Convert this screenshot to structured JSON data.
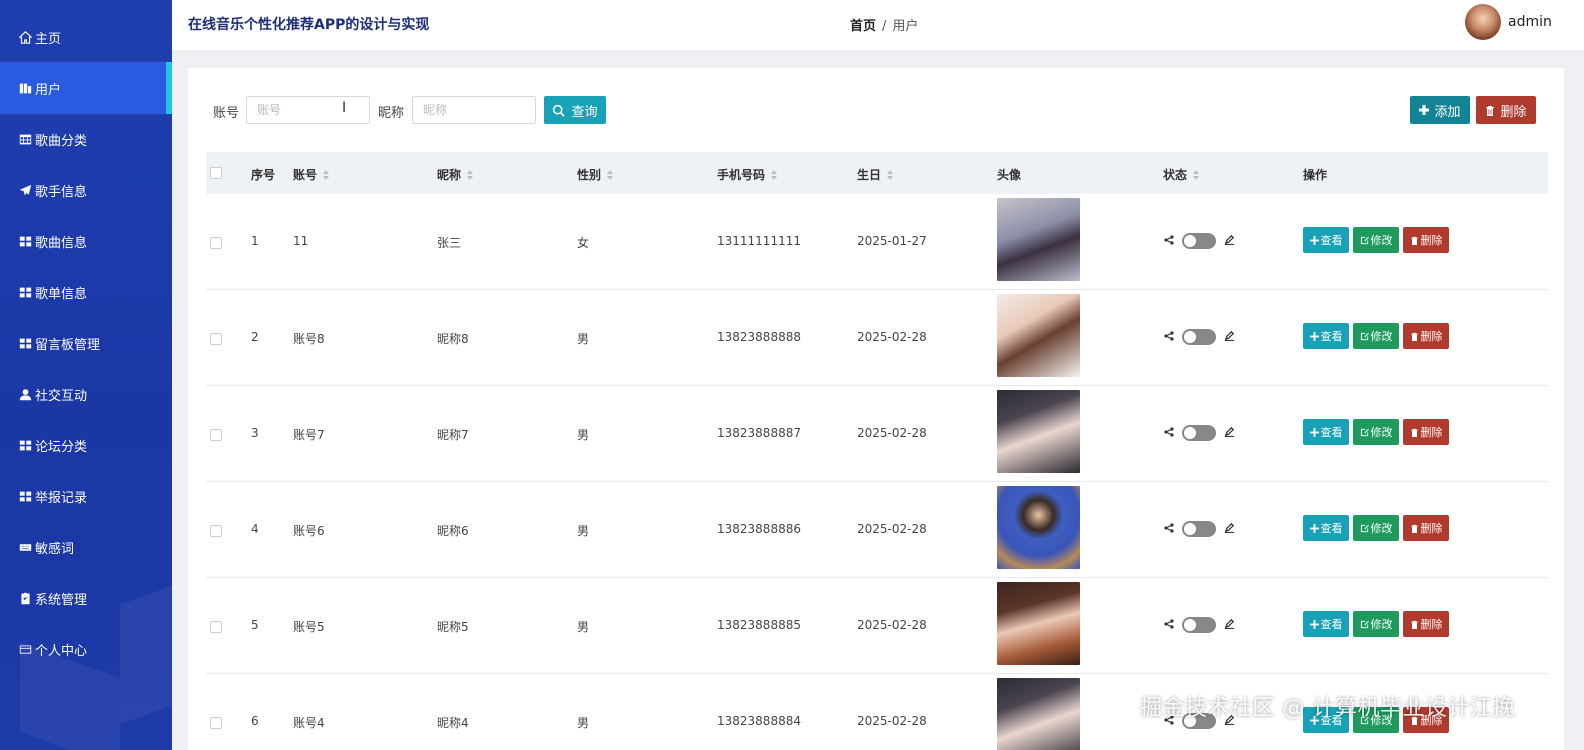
{
  "header": {
    "app_title": "在线音乐个性化推荐APP的设计与实现",
    "breadcrumb_home": "首页",
    "breadcrumb_sep": "/",
    "breadcrumb_current": "用户",
    "username": "admin"
  },
  "sidebar": {
    "items": [
      {
        "label": "主页",
        "icon": "home-icon"
      },
      {
        "label": "用户",
        "icon": "columns-icon",
        "active": true
      },
      {
        "label": "歌曲分类",
        "icon": "table-icon"
      },
      {
        "label": "歌手信息",
        "icon": "send-icon"
      },
      {
        "label": "歌曲信息",
        "icon": "grid-icon"
      },
      {
        "label": "歌单信息",
        "icon": "grid-icon"
      },
      {
        "label": "留言板管理",
        "icon": "grid-icon"
      },
      {
        "label": "社交互动",
        "icon": "user-icon"
      },
      {
        "label": "论坛分类",
        "icon": "grid-icon"
      },
      {
        "label": "举报记录",
        "icon": "grid-icon"
      },
      {
        "label": "敏感词",
        "icon": "keyboard-icon"
      },
      {
        "label": "系统管理",
        "icon": "clipboard-icon"
      },
      {
        "label": "个人中心",
        "icon": "card-icon"
      }
    ]
  },
  "search": {
    "account_label": "账号",
    "account_placeholder": "账号",
    "nickname_label": "昵称",
    "nickname_placeholder": "昵称",
    "query_button": "查询"
  },
  "toolbar": {
    "add_button": "添加",
    "delete_button": "删除"
  },
  "table": {
    "headers": {
      "index": "序号",
      "account": "账号",
      "nickname": "昵称",
      "gender": "性别",
      "phone": "手机号码",
      "birthday": "生日",
      "avatar": "头像",
      "status": "状态",
      "actions": "操作"
    },
    "row_actions": {
      "view": "查看",
      "edit": "修改",
      "delete": "删除"
    },
    "rows": [
      {
        "index": "1",
        "account": "11",
        "nickname": "张三",
        "gender": "女",
        "phone": "13111111111",
        "birthday": "2025-01-27"
      },
      {
        "index": "2",
        "account": "账号8",
        "nickname": "昵称8",
        "gender": "男",
        "phone": "13823888888",
        "birthday": "2025-02-28"
      },
      {
        "index": "3",
        "account": "账号7",
        "nickname": "昵称7",
        "gender": "男",
        "phone": "13823888887",
        "birthday": "2025-02-28"
      },
      {
        "index": "4",
        "account": "账号6",
        "nickname": "昵称6",
        "gender": "男",
        "phone": "13823888886",
        "birthday": "2025-02-28"
      },
      {
        "index": "5",
        "account": "账号5",
        "nickname": "昵称5",
        "gender": "男",
        "phone": "13823888885",
        "birthday": "2025-02-28"
      },
      {
        "index": "6",
        "account": "账号4",
        "nickname": "昵称4",
        "gender": "男",
        "phone": "13823888884",
        "birthday": "2025-02-28"
      }
    ]
  },
  "watermark": "掘金技术社区 @ 计算机毕业设计江挽",
  "colors": {
    "sidebar": "#1f3fb0",
    "sidebar_active": "#2a5ae0",
    "accent_cyan": "#17a2b8",
    "success_green": "#1e9a5e",
    "danger_red": "#b03a2e"
  }
}
